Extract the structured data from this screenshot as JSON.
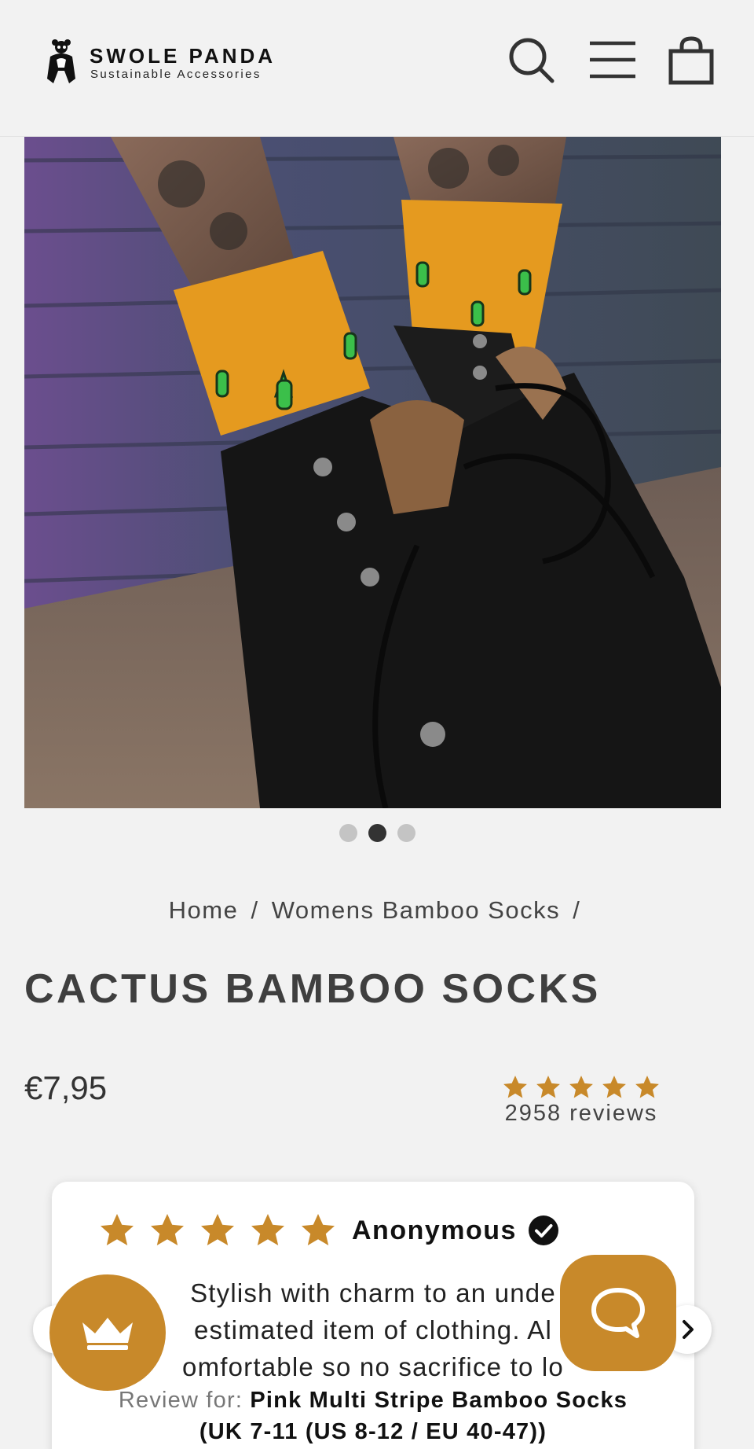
{
  "header": {
    "brand_name": "SWOLE PANDA",
    "brand_tagline": "Sustainable Accessories",
    "logo_icon": "panda-logo-icon",
    "icons": [
      "search-icon",
      "menu-icon",
      "cart-icon"
    ]
  },
  "gallery": {
    "image_alt": "Cactus bamboo socks worn with black lace-up boots",
    "slide_count": 3,
    "active_slide": 2
  },
  "breadcrumb": {
    "home": "Home",
    "separator": "/",
    "category": "Womens Bamboo Socks",
    "trailing_separator": "/"
  },
  "product": {
    "title": "CACTUS BAMBOO SOCKS",
    "price": "€7,95"
  },
  "rating": {
    "stars": 5,
    "count_label": "2958 reviews"
  },
  "review": {
    "stars": 5,
    "author": "Anonymous",
    "line1": "Stylish with charm to an unde",
    "line2": "estimated item of clothing. Al",
    "line3": "omfortable so no sacrifice to lo",
    "for_label": "Review for:",
    "product_line1": "Pink Multi Stripe Bamboo Socks",
    "product_line2": "(UK 7-11 (US 8-12 / EU 40-47))"
  },
  "colors": {
    "accent": "#c8892a",
    "star": "#c8892a",
    "background": "#f2f2f2",
    "title": "#3f3f3f"
  }
}
